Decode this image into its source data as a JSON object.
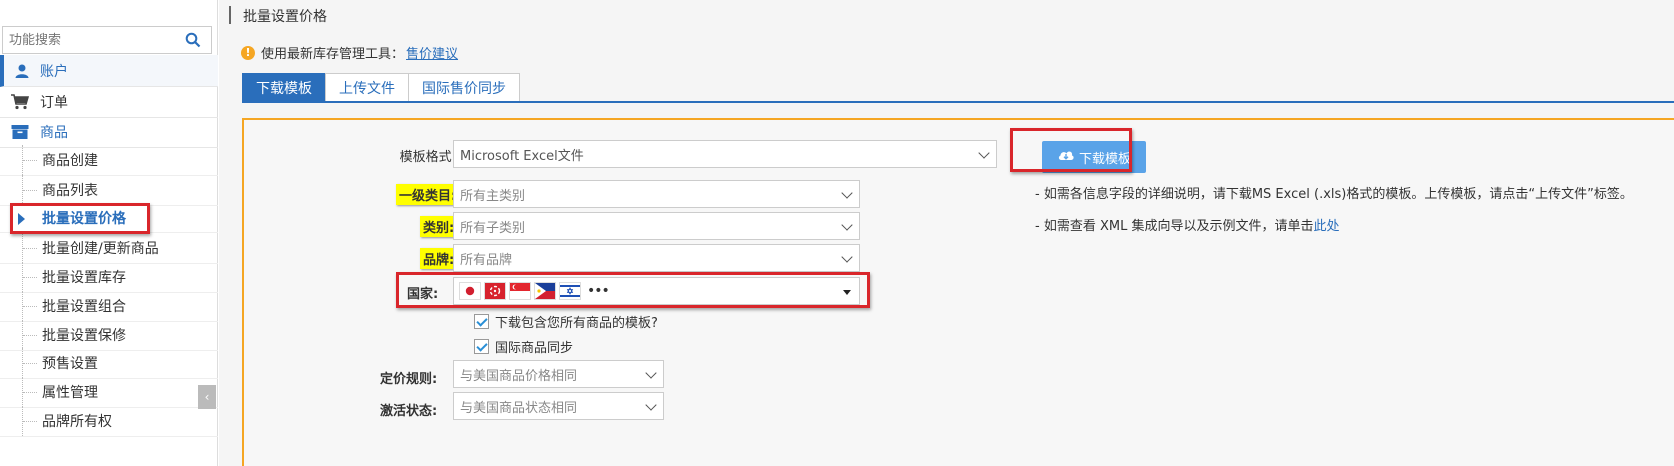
{
  "sidebar": {
    "search_placeholder": "功能搜索",
    "nav": [
      {
        "label": "账户",
        "icon": "user-icon"
      },
      {
        "label": "订单",
        "icon": "cart-icon"
      },
      {
        "label": "商品",
        "icon": "box-icon"
      }
    ],
    "sub_items": [
      {
        "label": "商品创建"
      },
      {
        "label": "商品列表"
      },
      {
        "label": "批量设置价格"
      },
      {
        "label": "批量创建/更新商品"
      },
      {
        "label": "批量设置库存"
      },
      {
        "label": "批量设置组合"
      },
      {
        "label": "批量设置保修"
      },
      {
        "label": "预售设置"
      },
      {
        "label": "属性管理"
      },
      {
        "label": "品牌所有权"
      }
    ],
    "collapse_glyph": "‹"
  },
  "main": {
    "page_title": "批量设置价格",
    "notice": {
      "text": "使用最新库存管理工具：",
      "link": "售价建议",
      "icon": "warning-icon"
    },
    "tabs": [
      {
        "label": "下载模板",
        "active": true
      },
      {
        "label": "上传文件",
        "active": false
      },
      {
        "label": "国际售价同步",
        "active": false
      }
    ],
    "form": {
      "template_format": {
        "label": "模板格式:",
        "value": "Microsoft Excel文件"
      },
      "category1": {
        "label": "一级类目:",
        "value": "所有主类别"
      },
      "category": {
        "label": "类别:",
        "value": "所有子类别"
      },
      "brand": {
        "label": "品牌:",
        "value": "所有品牌"
      },
      "country": {
        "label": "国家:",
        "flags": [
          "japan-flag-icon",
          "hong-kong-flag-icon",
          "singapore-flag-icon",
          "philippines-flag-icon",
          "israel-flag-icon"
        ],
        "more": "•••"
      },
      "checkbox_all": {
        "label": "下载包含您所有商品的模板?",
        "checked": true
      },
      "checkbox_intl": {
        "label": "国际商品同步",
        "checked": true
      },
      "pricing_rule": {
        "label": "定价规则:",
        "value": "与美国商品价格相同"
      },
      "activation": {
        "label": "激活状态:",
        "value": "与美国商品状态相同"
      }
    },
    "download_button": "下载模板",
    "info": {
      "line1": "- 如需各信息字段的详细说明，请下载MS Excel (.xls)格式的模板。上传模板，请点击“上传文件”标签。",
      "line2_prefix": "- 如需查看 XML 集成向导以及示例文件，请单击",
      "line2_link": "此处"
    },
    "colors": {
      "accent": "#2a6ebb",
      "highlight_box": "#d9262b",
      "panel_border": "#f5a623",
      "button": "#5aa3e8"
    }
  }
}
